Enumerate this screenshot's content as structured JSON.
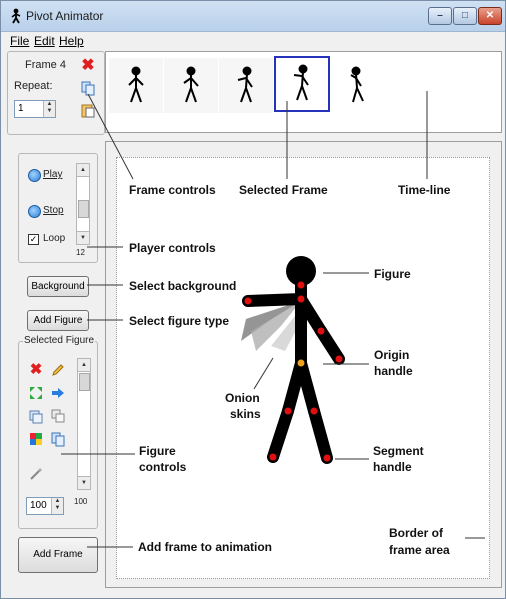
{
  "window": {
    "title": "Pivot Animator"
  },
  "menu": {
    "items": [
      "File",
      "Edit",
      "Help"
    ]
  },
  "frame_controls": {
    "frame_label": "Frame 4",
    "repeat_label": "Repeat:",
    "repeat_value": "1"
  },
  "player": {
    "play_label": "Play",
    "stop_label": "Stop",
    "loop_label": "Loop",
    "loop_checked": true,
    "speed_value": "12"
  },
  "buttons": {
    "background": "Background",
    "add_figure": "Add Figure",
    "add_frame": "Add Frame"
  },
  "figure_panel": {
    "title": "Selected Figure",
    "size_value": "100",
    "slider_value": "100"
  },
  "timeline": {
    "frame_count": 5,
    "selected_frame": 4
  },
  "annotations": {
    "frame_controls": "Frame controls",
    "selected_frame": "Selected Frame",
    "timeline": "Time-line",
    "player_controls": "Player controls",
    "select_background": "Select background",
    "figure": "Figure",
    "select_figure_type": "Select figure type",
    "origin_handle_1": "Origin",
    "origin_handle_2": "handle",
    "onion_skins_1": "Onion",
    "onion_skins_2": "skins",
    "figure_controls_1": "Figure",
    "figure_controls_2": "controls",
    "segment_handle_1": "Segment",
    "segment_handle_2": "handle",
    "border_1": "Border of",
    "border_2": "frame area",
    "add_frame": "Add frame to animation"
  },
  "colors": {
    "selected_frame_border": "#2433b9",
    "handle_red": "#e01010",
    "origin_handle": "#f0a020",
    "figure": "#000000"
  },
  "icons": {
    "frame_controls": [
      "delete-frame-icon",
      "copy-frame-icon",
      "paste-frame-icon"
    ],
    "figure_controls": [
      "delete-figure-icon",
      "edit-figure-icon",
      "flip-figure-icon",
      "forward-figure-icon",
      "copy-figure-icon",
      "duplicate-figure-icon",
      "color-figure-icon",
      "paste-figure-icon",
      "wand-figure-icon"
    ]
  }
}
